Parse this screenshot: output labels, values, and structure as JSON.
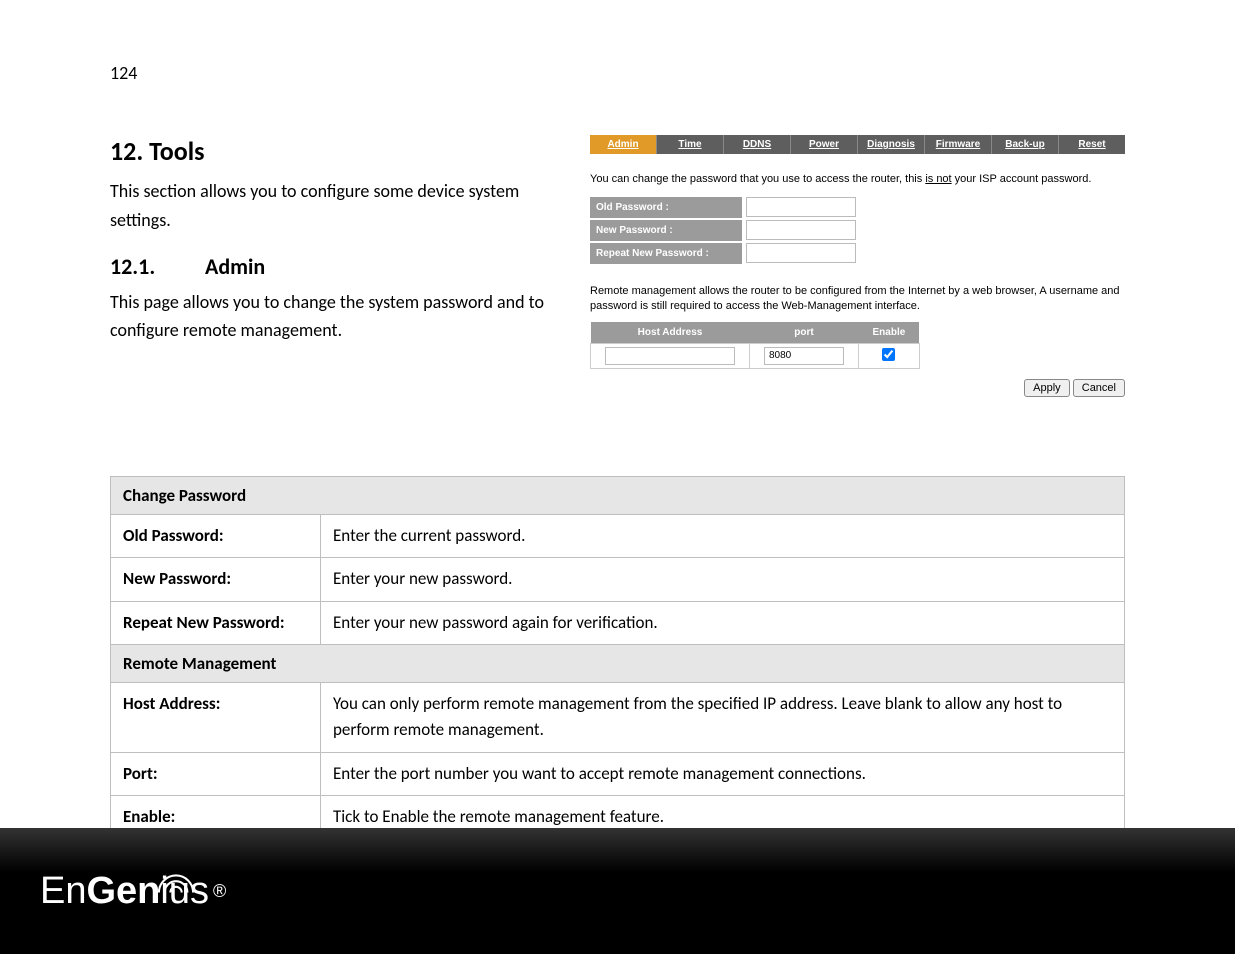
{
  "page_number": "124",
  "section_heading": "12.  Tools",
  "section_intro": "This section allows you to configure some device system settings.",
  "subsection_number": "12.1.",
  "subsection_title": "Admin",
  "subsection_intro": "This page allows you to change the system password and to configure remote management.",
  "tabs": {
    "admin": "Admin",
    "time": "Time",
    "ddns": "DDNS",
    "power": "Power",
    "diagnosis": "Diagnosis",
    "firmware": "Firmware",
    "backup": "Back-up",
    "reset": "Reset"
  },
  "help1_pre": "You can change the password that you use to access the router, this ",
  "help1_under": "is not",
  "help1_post": " your ISP account password.",
  "pw_labels": {
    "old": "Old Password :",
    "new": "New Password :",
    "repeat": "Repeat New Password :"
  },
  "remote_help": "Remote management allows the router to be configured from the Internet by a web browser, A username and password is still required to access the Web-Management interface.",
  "remote_headers": {
    "host": "Host Address",
    "port": "port",
    "enable": "Enable"
  },
  "remote_values": {
    "host": "",
    "port": "8080",
    "enable_checked": true
  },
  "buttons": {
    "apply": "Apply",
    "cancel": "Cancel"
  },
  "desc": {
    "change_pw_header": "Change Password",
    "old_pw_label": "Old Password:",
    "old_pw_text": "Enter the current password.",
    "new_pw_label": "New Password:",
    "new_pw_text": "Enter your new password.",
    "repeat_pw_label": "Repeat New Password:",
    "repeat_pw_text": "Enter your new password again for verification.",
    "remote_header": "Remote Management",
    "host_label": "Host Address:",
    "host_text": "You can only perform remote management from the specified IP address. Leave blank to allow any host to perform remote management.",
    "port_label": "Port:",
    "port_text": "Enter the port number you want to accept remote management connections.",
    "enable_label": "Enable:",
    "enable_text": "Tick to Enable the remote management feature."
  },
  "logo": {
    "en": "En",
    "gen": "Gen",
    "ius": "ius",
    "reg": "®"
  }
}
